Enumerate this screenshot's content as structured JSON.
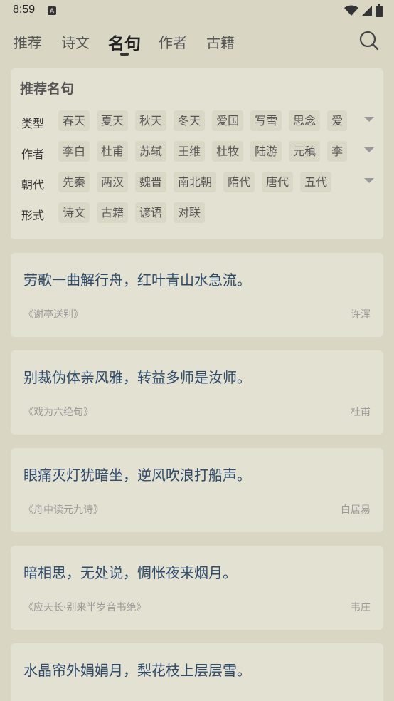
{
  "status_bar": {
    "time": "8:59",
    "notification_icon": "A"
  },
  "tabs": [
    {
      "label": "推荐",
      "active": false
    },
    {
      "label": "诗文",
      "active": false
    },
    {
      "label": "名句",
      "active": true
    },
    {
      "label": "作者",
      "active": false
    },
    {
      "label": "古籍",
      "active": false
    }
  ],
  "filter": {
    "title": "推荐名句",
    "rows": [
      {
        "label": "类型",
        "chips": [
          "春天",
          "夏天",
          "秋天",
          "冬天",
          "爱国",
          "写雪",
          "思念",
          "爱"
        ]
      },
      {
        "label": "作者",
        "chips": [
          "李白",
          "杜甫",
          "苏轼",
          "王维",
          "杜牧",
          "陆游",
          "元稹",
          "李"
        ]
      },
      {
        "label": "朝代",
        "chips": [
          "先秦",
          "两汉",
          "魏晋",
          "南北朝",
          "隋代",
          "唐代",
          "五代"
        ]
      },
      {
        "label": "形式",
        "chips": [
          "诗文",
          "古籍",
          "谚语",
          "对联"
        ]
      }
    ]
  },
  "quotes": [
    {
      "text": "劳歌一曲解行舟，红叶青山水急流。",
      "source": "《谢亭送别》",
      "author": "许浑"
    },
    {
      "text": "别裁伪体亲风雅，转益多师是汝师。",
      "source": "《戏为六绝句》",
      "author": "杜甫"
    },
    {
      "text": "眼痛灭灯犹暗坐，逆风吹浪打船声。",
      "source": "《舟中读元九诗》",
      "author": "白居易"
    },
    {
      "text": "暗相思，无处说，惆怅夜来烟月。",
      "source": "《应天长·别来半岁音书绝》",
      "author": "韦庄"
    },
    {
      "text": "水晶帘外娟娟月，梨花枝上层层雪。",
      "source": "",
      "author": ""
    }
  ],
  "icons": {
    "search": "search-icon",
    "wifi": "wifi-icon",
    "signal": "signal-icon",
    "battery": "battery-icon",
    "expand": "chevron-down-icon"
  }
}
